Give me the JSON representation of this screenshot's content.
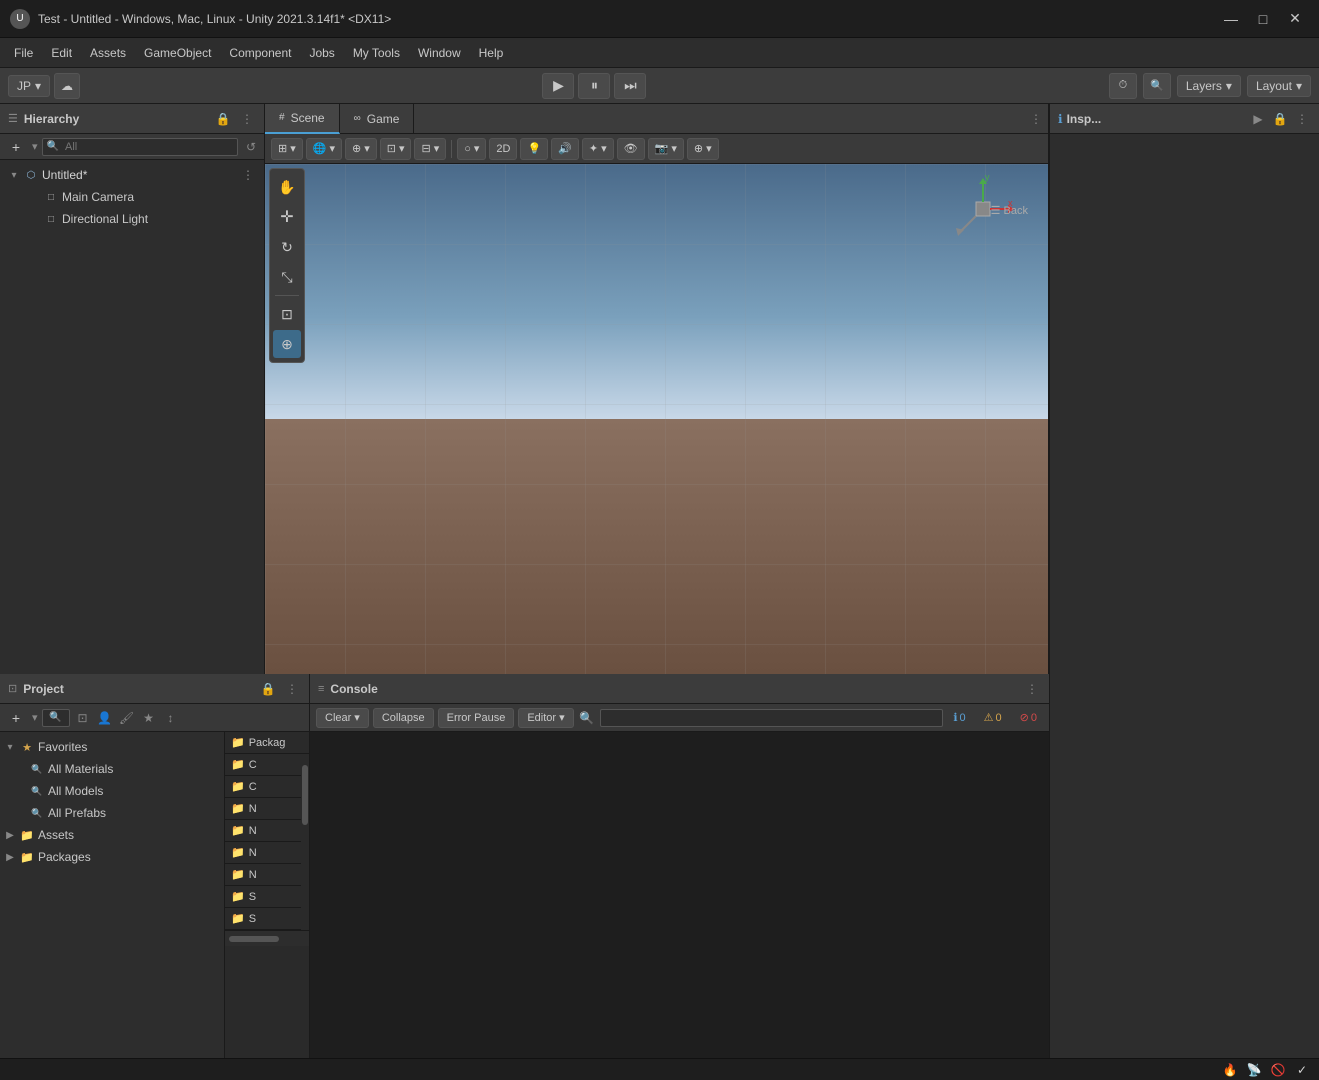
{
  "titleBar": {
    "title": "Test - Untitled - Windows, Mac, Linux - Unity 2021.3.14f1* <DX11>",
    "appIcon": "U",
    "minimizeBtn": "—",
    "restoreBtn": "□",
    "closeBtn": "✕"
  },
  "menuBar": {
    "items": [
      "File",
      "Edit",
      "Assets",
      "GameObject",
      "Component",
      "Jobs",
      "My Tools",
      "Window",
      "Help"
    ]
  },
  "toolbar": {
    "accountLabel": "JP",
    "cloudIcon": "☁",
    "playIcon": "▶",
    "pauseIcon": "⏸",
    "stepIcon": "⏭",
    "layersLabel": "Layers",
    "layersDropArrow": "▾",
    "layoutLabel": "Layout",
    "layoutDropArrow": "▾",
    "historyIcon": "⏱",
    "searchIcon": "🔍"
  },
  "hierarchy": {
    "title": "Hierarchy",
    "lockIcon": "🔒",
    "menuIcon": "⋮",
    "addBtn": "+",
    "searchPlaceholder": "All",
    "searchIcon": "🔍",
    "resetIcon": "↺",
    "items": [
      {
        "label": "Untitled*",
        "type": "scene",
        "level": 0,
        "hasArrow": true,
        "threeDotsVisible": true
      },
      {
        "label": "Main Camera",
        "type": "camera",
        "level": 1,
        "hasArrow": false
      },
      {
        "label": "Directional Light",
        "type": "light",
        "level": 1,
        "hasArrow": false
      }
    ]
  },
  "scene": {
    "tabs": [
      {
        "label": "Scene",
        "icon": "#",
        "active": true
      },
      {
        "label": "Game",
        "icon": "∞",
        "active": false
      }
    ],
    "toolbarItems": [
      {
        "label": "⊞",
        "dropdown": true
      },
      {
        "label": "🌐",
        "dropdown": true
      },
      {
        "label": "⊕",
        "dropdown": true
      },
      {
        "label": "⊡",
        "dropdown": true
      },
      {
        "label": "⊟",
        "dropdown": true
      }
    ],
    "sceneTools": [
      {
        "label": "✋",
        "name": "hand-tool",
        "active": false
      },
      {
        "label": "✛",
        "name": "move-tool",
        "active": false
      },
      {
        "label": "↻",
        "name": "rotate-tool",
        "active": false
      },
      {
        "label": "⤡",
        "name": "scale-tool",
        "active": false
      },
      {
        "label": "⊡",
        "name": "rect-tool",
        "active": false
      },
      {
        "label": "⊕",
        "name": "transform-tool",
        "active": true
      }
    ],
    "2dBtn": "2D",
    "lightingBtn": "💡",
    "audioBtn": "🔊",
    "effectsBtn": "✦",
    "visibilityBtn": "👁",
    "cameraBtn": "📷",
    "gizmoBtn": "⊕",
    "gizmoBackLabel": "Back"
  },
  "inspector": {
    "title": "Inspector",
    "infoIcon": "ℹ",
    "lockIcon": "🔒",
    "menuIcon": "⋮",
    "inspectorLabel": "Insp..."
  },
  "project": {
    "title": "Project",
    "lockIcon": "🔒",
    "menuIcon": "⋮",
    "addBtn": "+",
    "searchIcon": "🔍",
    "favIcon": "⊡",
    "userIcon": "👤",
    "brushIcon": "🖌",
    "starIcon": "★",
    "sortIcon": "↕",
    "treeItems": [
      {
        "label": "Favorites",
        "level": 0,
        "hasArrow": true,
        "isOpen": true,
        "iconType": "star"
      },
      {
        "label": "All Materials",
        "level": 1,
        "hasArrow": false,
        "iconType": "search"
      },
      {
        "label": "All Models",
        "level": 1,
        "hasArrow": false,
        "iconType": "search"
      },
      {
        "label": "All Prefabs",
        "level": 1,
        "hasArrow": false,
        "iconType": "search"
      },
      {
        "label": "Assets",
        "level": 0,
        "hasArrow": true,
        "isOpen": false,
        "iconType": "folder"
      },
      {
        "label": "Packages",
        "level": 0,
        "hasArrow": true,
        "isOpen": false,
        "iconType": "folder"
      }
    ],
    "rightPanelTitle": "Packag",
    "rightPanelItems": [
      "C",
      "C",
      "N",
      "N",
      "N",
      "N",
      "S",
      "S"
    ]
  },
  "console": {
    "title": "Console",
    "menuIcon": "⋮",
    "clearBtn": "Clear",
    "clearArrow": "▾",
    "collapseBtn": "Collapse",
    "errorPauseBtn": "Error Pause",
    "editorBtn": "Editor",
    "editorArrow": "▾",
    "searchIcon": "🔍",
    "infoCount": "0",
    "warnCount": "0",
    "errorCount": "0",
    "infoIcon": "ℹ",
    "warnIcon": "⚠",
    "errorIcon": "⊘"
  },
  "statusBar": {
    "icons": [
      "🔥",
      "📡",
      "🚫",
      "✓"
    ]
  }
}
